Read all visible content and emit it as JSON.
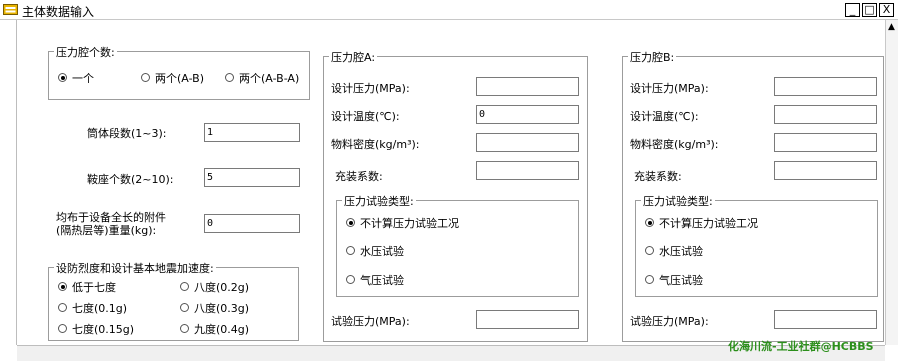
{
  "window": {
    "title": "主体数据输入",
    "min": "_",
    "max": "□",
    "close": "X"
  },
  "chamber_count": {
    "legend": "压力腔个数:",
    "options": [
      "一个",
      "两个(A-B)",
      "两个(A-B-A)"
    ],
    "selected": 0
  },
  "fields": {
    "cylinder_segments": {
      "label": "筒体段数(1~3):",
      "value": "1"
    },
    "saddle_count": {
      "label": "鞍座个数(2~10):",
      "value": "5"
    },
    "attachment_weight": {
      "label_line1": "均布于设备全长的附件",
      "label_line2": "(隔热层等)重量(kg):",
      "value": "0"
    }
  },
  "seismic": {
    "legend": "设防烈度和设计基本地震加速度:",
    "options": [
      "低于七度",
      "八度(0.2g)",
      "七度(0.1g)",
      "八度(0.3g)",
      "七度(0.15g)",
      "九度(0.4g)"
    ],
    "selected": 0
  },
  "chamber_a": {
    "legend": "压力腔A:",
    "design_pressure": {
      "label": "设计压力(MPa):",
      "value": ""
    },
    "design_temp": {
      "label": "设计温度(℃):",
      "value": "0"
    },
    "density": {
      "label": "物料密度(kg/m³):",
      "value": ""
    },
    "fill_factor": {
      "label": "充装系数:",
      "value": ""
    },
    "test_type": {
      "legend": "压力试验类型:",
      "options": [
        "不计算压力试验工况",
        "水压试验",
        "气压试验"
      ],
      "selected": 0
    },
    "test_pressure": {
      "label": "试验压力(MPa):",
      "value": ""
    }
  },
  "chamber_b": {
    "legend": "压力腔B:",
    "design_pressure": {
      "label": "设计压力(MPa):",
      "value": ""
    },
    "design_temp": {
      "label": "设计温度(℃):",
      "value": ""
    },
    "density": {
      "label": "物料密度(kg/m³):",
      "value": ""
    },
    "fill_factor": {
      "label": "充装系数:",
      "value": ""
    },
    "test_type": {
      "legend": "压力试验类型:",
      "options": [
        "不计算压力试验工况",
        "水压试验",
        "气压试验"
      ],
      "selected": 0
    },
    "test_pressure": {
      "label": "试验压力(MPa):",
      "value": ""
    }
  },
  "watermark": "化海川流-工业社群@HCBBS",
  "colors": {
    "frame_border": "#9c9c9c",
    "watermark": "#2c8f1c",
    "icon": "#e8b400"
  }
}
